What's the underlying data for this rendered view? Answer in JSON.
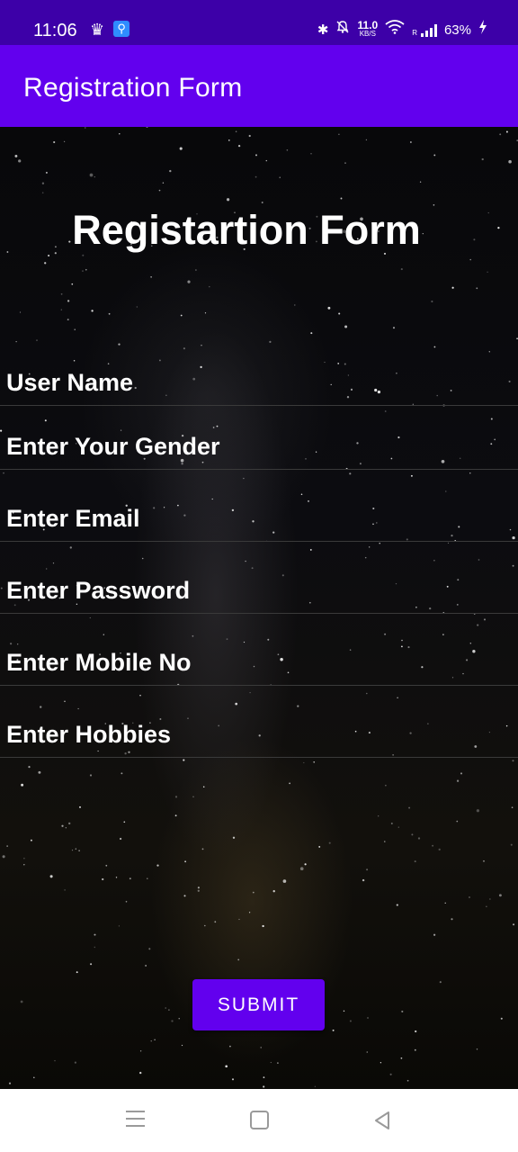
{
  "status_bar": {
    "time": "11:06",
    "net_speed_value": "11.0",
    "net_speed_unit": "KB/S",
    "signal_label": "R",
    "battery": "63%",
    "background_color": "#3d00a8"
  },
  "app_bar": {
    "title": "Registration Form",
    "background_color": "#6200ee"
  },
  "form": {
    "heading": "Registartion Form",
    "fields": [
      {
        "placeholder": "User Name",
        "value": ""
      },
      {
        "placeholder": "Enter Your Gender",
        "value": ""
      },
      {
        "placeholder": "Enter Email",
        "value": ""
      },
      {
        "placeholder": "Enter Password",
        "value": ""
      },
      {
        "placeholder": "Enter Mobile No",
        "value": ""
      },
      {
        "placeholder": "Enter Hobbies",
        "value": ""
      }
    ],
    "submit_label": "SUBMIT"
  },
  "icons": {
    "status_left": [
      "crown-icon",
      "usb-icon"
    ],
    "status_right": [
      "bluetooth-icon",
      "bell-muted-icon",
      "wifi-icon",
      "signal-icon",
      "charging-icon"
    ],
    "nav": [
      "menu-icon",
      "home-icon",
      "back-icon"
    ]
  }
}
